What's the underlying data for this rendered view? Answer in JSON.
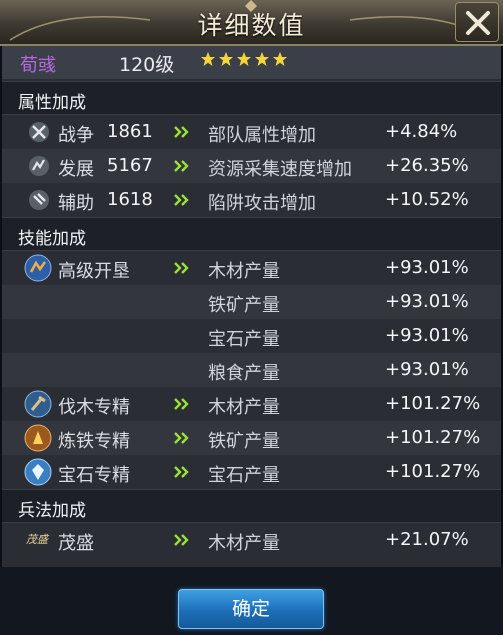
{
  "title": "详细数值",
  "hero": {
    "name": "荀彧",
    "level": "120级",
    "stars": 5
  },
  "sections": {
    "attributes": "属性加成",
    "skills": "技能加成",
    "tactics": "兵法加成"
  },
  "attribute_rows": [
    {
      "icon": "crossed-swords-icon",
      "label": "战争",
      "value": "1861",
      "effect": "部队属性增加",
      "bonus": "+4.84%"
    },
    {
      "icon": "development-icon",
      "label": "发展",
      "value": "5167",
      "effect": "资源采集速度增加",
      "bonus": "+26.35%"
    },
    {
      "icon": "assist-icon",
      "label": "辅助",
      "value": "1618",
      "effect": "陷阱攻击增加",
      "bonus": "+10.52%"
    }
  ],
  "skill_rows": [
    {
      "icon": "advanced-farming-icon",
      "label": "高级开垦",
      "effect": "木材产量",
      "bonus": "+93.01%"
    },
    {
      "label": "",
      "effect": "铁矿产量",
      "bonus": "+93.01%"
    },
    {
      "label": "",
      "effect": "宝石产量",
      "bonus": "+93.01%"
    },
    {
      "label": "",
      "effect": "粮食产量",
      "bonus": "+93.01%"
    },
    {
      "icon": "logging-mastery-icon",
      "label": "伐木专精",
      "effect": "木材产量",
      "bonus": "+101.27%"
    },
    {
      "icon": "smelting-mastery-icon",
      "label": "炼铁专精",
      "effect": "铁矿产量",
      "bonus": "+101.27%"
    },
    {
      "icon": "gem-mastery-icon",
      "label": "宝石专精",
      "effect": "宝石产量",
      "bonus": "+101.27%"
    }
  ],
  "tactic_rows": [
    {
      "icon": "maosheng-tactic-icon",
      "icon_text": "茂盛",
      "label": "茂盛",
      "effect": "木材产量",
      "bonus": "+21.07%"
    }
  ],
  "confirm_label": "确定",
  "colors": {
    "hero_name": "#b46be0",
    "arrow": "#9be03a",
    "button": "#2a85cf"
  }
}
